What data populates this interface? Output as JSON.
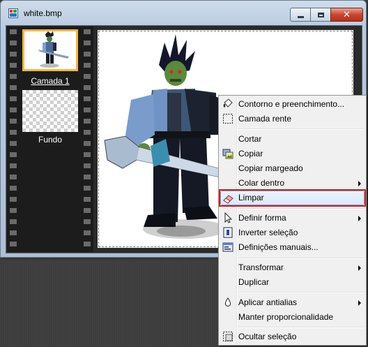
{
  "window": {
    "title": "white.bmp",
    "minimize_icon": "minimize-icon",
    "maximize_icon": "maximize-icon",
    "close_icon": "close-icon",
    "close_glyph": "✕"
  },
  "layers": [
    {
      "label": "Camada 1",
      "active": true
    },
    {
      "label": "Fundo",
      "active": false
    }
  ],
  "context_menu": {
    "items": [
      {
        "label": "Contorno e preenchimento...",
        "icon": "paint-bucket-icon"
      },
      {
        "label": "Camada rente",
        "icon": "dashed-selection-icon"
      },
      {
        "label": "Cortar",
        "icon": ""
      },
      {
        "label": "Copiar",
        "icon": "copy-image-icon"
      },
      {
        "label": "Copiar margeado",
        "icon": ""
      },
      {
        "label": "Colar dentro",
        "icon": "",
        "submenu": true
      },
      {
        "label": "Limpar",
        "icon": "eraser-icon",
        "highlighted": true
      },
      {
        "label": "Definir forma",
        "icon": "pointer-icon",
        "submenu": true
      },
      {
        "label": "Inverter seleção",
        "icon": "invert-selection-icon"
      },
      {
        "label": "Definições manuais...",
        "icon": "manual-settings-icon"
      },
      {
        "label": "Transformar",
        "icon": "",
        "submenu": true
      },
      {
        "label": "Duplicar",
        "icon": ""
      },
      {
        "label": "Aplicar antialias",
        "icon": "water-drop-icon",
        "submenu": true
      },
      {
        "label": "Manter proporcionalidade",
        "icon": ""
      },
      {
        "label": "Ocultar seleção",
        "icon": "hide-selection-icon"
      }
    ]
  }
}
